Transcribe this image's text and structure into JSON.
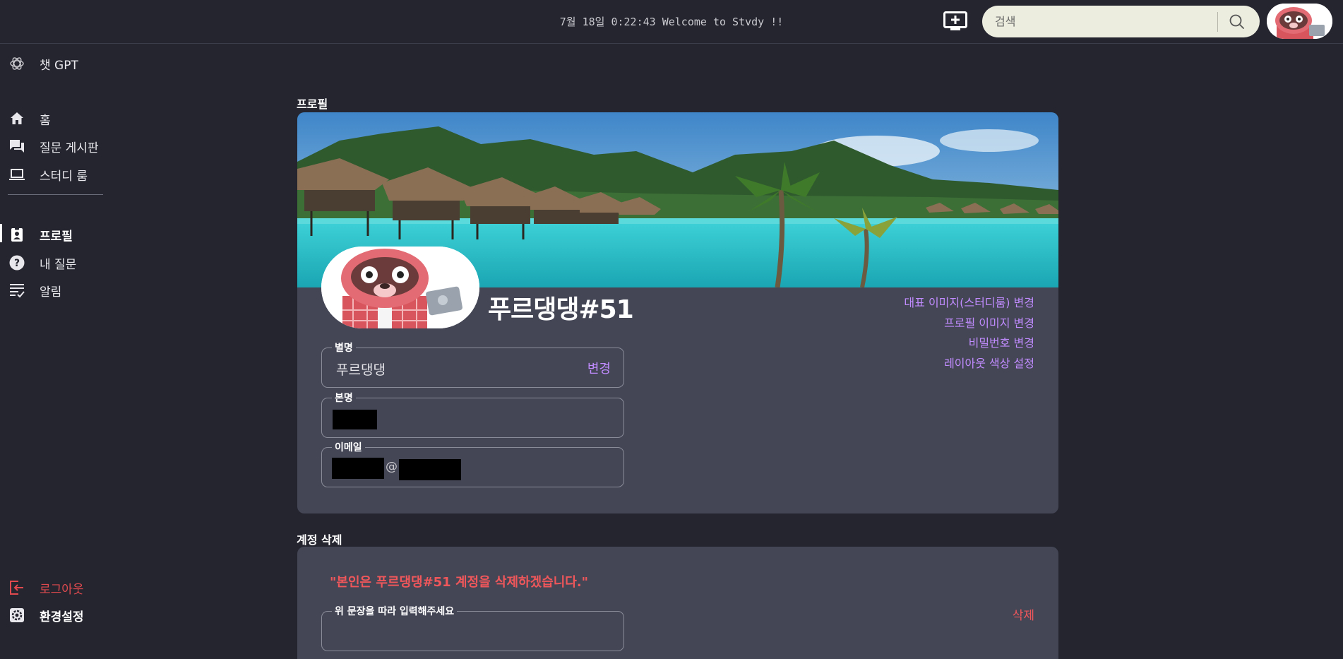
{
  "header": {
    "clock": "7월 18일 0:22:43 Welcome to Stvdy !!",
    "search_placeholder": "검색"
  },
  "sidebar": {
    "top": [
      {
        "label": "챗 GPT",
        "icon": "chatgpt-icon"
      }
    ],
    "main": [
      {
        "label": "홈",
        "icon": "home-icon"
      },
      {
        "label": "질문 게시판",
        "icon": "forum-icon"
      },
      {
        "label": "스터디 룸",
        "icon": "laptop-icon"
      }
    ],
    "personal": [
      {
        "label": "프로필",
        "icon": "profile-badge-icon",
        "active": true
      },
      {
        "label": "내 질문",
        "icon": "question-icon"
      },
      {
        "label": "알림",
        "icon": "notification-list-icon"
      }
    ],
    "bottom": [
      {
        "label": "로그아웃",
        "icon": "logout-icon"
      },
      {
        "label": "환경설정",
        "icon": "gear-icon"
      }
    ]
  },
  "profile": {
    "section_title": "프로필",
    "name": "푸르댕댕#51",
    "links": [
      "대표 이미지(스터디룸) 변경",
      "프로필 이미지 변경",
      "비밀번호 변경",
      "레이아웃 색상 설정"
    ],
    "nickname": {
      "label": "별명",
      "value": "푸르댕댕",
      "action": "변경"
    },
    "real_name": {
      "label": "본명",
      "value": ""
    },
    "email": {
      "label": "이메일",
      "at": "@"
    }
  },
  "delete_account": {
    "section_title": "계정 삭제",
    "quote": "\"본인은 푸르댕댕#51 계정을 삭제하겠습니다.\"",
    "input_label": "위 문장을 따라 입력해주세요",
    "input_value": "",
    "delete_button": "삭제"
  },
  "colors": {
    "background": "#24252f",
    "card": "#444656",
    "accent_purple": "#c18cff",
    "danger_red": "#f0575b"
  }
}
